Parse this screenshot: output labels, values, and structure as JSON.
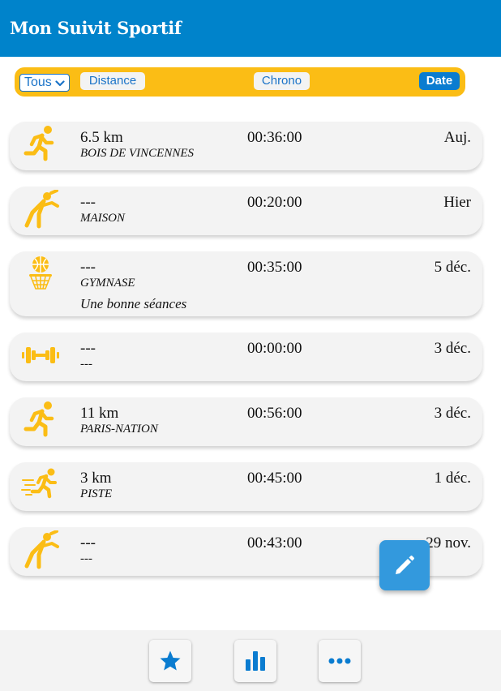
{
  "app": {
    "title": "Mon Suivit Sportif"
  },
  "filters": {
    "select_value": "Tous",
    "sort_distance": "Distance",
    "sort_chrono": "Chrono",
    "sort_date": "Date",
    "active": "Date"
  },
  "activities": [
    {
      "icon": "running-icon",
      "distance": "6.5 km",
      "place": "BOIS DE VINCENNES",
      "comment": "",
      "chrono": "00:36:00",
      "date": "Auj."
    },
    {
      "icon": "stretching-icon",
      "distance": "---",
      "place": "MAISON",
      "comment": "",
      "chrono": "00:20:00",
      "date": "Hier"
    },
    {
      "icon": "basketball-icon",
      "distance": "---",
      "place": "GYMNASE",
      "comment": "Une bonne séances",
      "chrono": "00:35:00",
      "date": "5 déc."
    },
    {
      "icon": "dumbbell-icon",
      "distance": "---",
      "place": "---",
      "comment": "",
      "chrono": "00:00:00",
      "date": "3 déc."
    },
    {
      "icon": "running-icon",
      "distance": "11 km",
      "place": "PARIS-NATION",
      "comment": "",
      "chrono": "00:56:00",
      "date": "3 déc."
    },
    {
      "icon": "sprint-icon",
      "distance": "3 km",
      "place": "PISTE",
      "comment": "",
      "chrono": "00:45:00",
      "date": "1 déc."
    },
    {
      "icon": "stretching-icon",
      "distance": "---",
      "place": "---",
      "comment": "",
      "chrono": "00:43:00",
      "date": "29 nov."
    }
  ],
  "fab": {
    "icon": "pencil-icon"
  },
  "footer": {
    "icons": [
      "star-icon",
      "chart-icon",
      "more-icon"
    ]
  },
  "colors": {
    "header": "#0083cb",
    "accent": "#fbbd15",
    "link": "#1a73c8",
    "fab": "#3399dd"
  }
}
